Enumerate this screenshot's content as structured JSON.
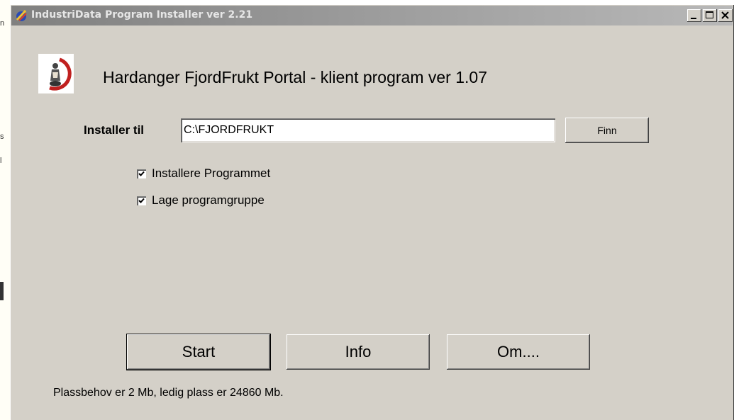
{
  "window": {
    "title": "IndustriData Program Installer ver 2.21"
  },
  "app": {
    "title": "Hardanger FjordFrukt Portal - klient program ver 1.07"
  },
  "install": {
    "label": "Installer til",
    "path_value": "C:\\FJORDFRUKT",
    "browse_label": "Finn"
  },
  "options": [
    {
      "label": "Installere Programmet",
      "checked": true
    },
    {
      "label": "Lage programgruppe",
      "checked": true
    }
  ],
  "buttons": {
    "start": "Start",
    "info": "Info",
    "about": "Om...."
  },
  "status": {
    "text": "Plassbehov er 2 Mb, ledig plass er 24860 Mb."
  },
  "icons": {
    "title": "installer-app-icon",
    "logo": "fjordfrukt-logo-icon",
    "minimize": "minimize-icon",
    "maximize": "maximize-icon",
    "close": "close-icon",
    "check": "checkmark-icon"
  }
}
